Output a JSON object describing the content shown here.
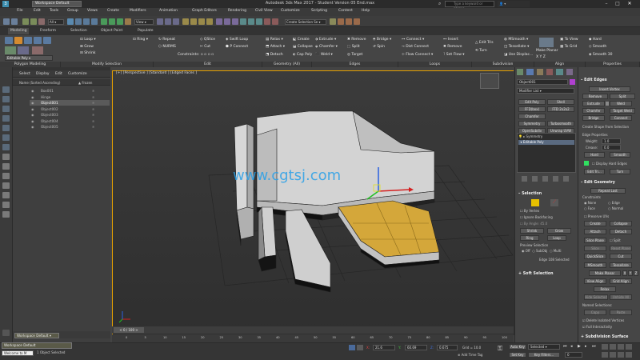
{
  "window": {
    "title": "Autodesk 3ds Max 2017 - Student Version   05 End.max",
    "workspace_label": "Workspace Default",
    "search_placeholder": "Type a keyword or phrase"
  },
  "menu": [
    "File",
    "Edit",
    "Tools",
    "Group",
    "Views",
    "Create",
    "Modifiers",
    "Animation",
    "Graph Editors",
    "Rendering",
    "Civil View",
    "Customize",
    "Scripting",
    "Content",
    "Help"
  ],
  "toolbar": {
    "view_dropdown": "View",
    "selection_set": "Create Selection Se"
  },
  "ribbon": {
    "tabs": [
      "Modeling",
      "Freeform",
      "Selection",
      "Object Paint",
      "Populate"
    ],
    "active_tab": "Modeling",
    "object_type": "Editable Poly",
    "row1": [
      "Loop",
      "Ring",
      "Repeat",
      "QSlice",
      "Swift Loop",
      "Relax",
      "Create",
      "Extrude",
      "Remove",
      "Bridge",
      "Connect",
      "Insert",
      "Edit Tris",
      "MSmooth",
      "To View",
      "Hard"
    ],
    "row2": [
      "Grow",
      "Shrink",
      "NURMS",
      "Cut",
      "P Connect",
      "Attach",
      "Collapse",
      "Chamfer",
      "Split",
      "Spin",
      "Dist Connect",
      "Remove",
      "Turn",
      "Tessellate",
      "To Grid",
      "Smooth"
    ],
    "row3": [
      "Constraints:",
      "Detach",
      "Cap Poly",
      "Weld",
      "Target",
      "Flow Connect",
      "Set Flow",
      "Use Displac...",
      "Make Planar",
      "X",
      "Y",
      "Z",
      "Smooth 30"
    ],
    "groups": [
      "Polygon Modeling",
      "Modify Selection",
      "Edit",
      "Geometry (All)",
      "Edges",
      "Loops",
      "Subdivision",
      "Align",
      "Properties"
    ]
  },
  "scene_explorer": {
    "tabs": [
      "Select",
      "Display",
      "Edit",
      "Customize"
    ],
    "column_name": "Name (Sorted Ascending)",
    "column_frozen": "Frozen",
    "items": [
      {
        "name": "Box001",
        "selected": false
      },
      {
        "name": "Hinge",
        "selected": false
      },
      {
        "name": "Object001",
        "selected": true
      },
      {
        "name": "Object002",
        "selected": false
      },
      {
        "name": "Object003",
        "selected": false
      },
      {
        "name": "Object004",
        "selected": false
      },
      {
        "name": "Object005",
        "selected": false
      }
    ],
    "workspace": "Workspace Default"
  },
  "viewport": {
    "label": "[+] [Perspective ] [Standard ] [Edged Faces ]",
    "watermark": "www.cgtsj.com",
    "colors": {
      "selected_faces": "#d4a73a",
      "frame": "#e5a000"
    }
  },
  "command_panel": {
    "object_name": "Object001",
    "modifier_list": "Modifier List",
    "buttons": [
      "Edit Poly",
      "Shell",
      "FFD(box)",
      "FFD 2x2x2",
      "Chamfer",
      "Symmetry",
      "Turbosmooth",
      "OpenSubdiv",
      "Unwrap UVW"
    ],
    "stack": [
      "Symmetry",
      "Editable Poly"
    ],
    "selection_header": "Selection",
    "by_vertex": "By Vertex",
    "ignore_backfacing": "Ignore Backfacing",
    "by_angle": "By Angle:",
    "by_angle_value": "45.0",
    "shrink": "Shrink",
    "grow": "Grow",
    "ring": "Ring",
    "loop": "Loop",
    "preview_selection": "Preview Selection",
    "preview_options": [
      "Off",
      "SubObj",
      "Multi"
    ],
    "status": "Edge 108 Selected",
    "soft_selection": "Soft Selection"
  },
  "edit_edges": {
    "header": "Edit Edges",
    "insert_vertex": "Insert Vertex",
    "remove": "Remove",
    "split": "Split",
    "extrude": "Extrude",
    "weld": "Weld",
    "chamfer": "Chamfer",
    "target_weld": "Target Weld",
    "bridge": "Bridge",
    "connect": "Connect",
    "create_shape": "Create Shape From Selection",
    "edge_properties": "Edge Properties",
    "weight_label": "Weight:",
    "weight": "1.0",
    "crease_label": "Crease:",
    "crease": "0.0",
    "hard": "Hard",
    "smooth": "Smooth",
    "display_hard": "Display Hard Edges",
    "edit_tri": "Edit Tri...",
    "turn": "Turn"
  },
  "edit_geometry": {
    "header": "Edit Geometry",
    "repeat_last": "Repeat Last",
    "constraints": "Constraints",
    "constraint_options": [
      "None",
      "Edge",
      "Face",
      "Normal"
    ],
    "preserve_uvs": "Preserve UVs",
    "create": "Create",
    "collapse": "Collapse",
    "attach": "Attach",
    "detach": "Detach",
    "slice_plane": "Slice Plane",
    "split": "Split",
    "slice": "Slice",
    "reset_plane": "Reset Plane",
    "quickslice": "QuickSlice",
    "cut": "Cut",
    "msmooth": "MSmooth",
    "tessellate": "Tessellate",
    "make_planar": "Make Planar",
    "x": "X",
    "y": "Y",
    "z": "Z",
    "view_align": "View Align",
    "grid_align": "Grid Align",
    "relax": "Relax",
    "hide_selected": "Hide Selected",
    "unhide_all": "Unhide All",
    "named_selections": "Named Selections:",
    "copy": "Copy",
    "paste": "Paste",
    "delete_isolated": "Delete Isolated Vertices",
    "full_interactivity": "Full Interactivity",
    "subdivision_surface": "Subdivision Surface"
  },
  "timeline": {
    "frame": "0 / 100",
    "ticks": [
      "0",
      "5",
      "10",
      "15",
      "20",
      "25",
      "30",
      "35",
      "40",
      "45",
      "50",
      "55",
      "60",
      "65",
      "70",
      "75",
      "80",
      "85",
      "90",
      "95",
      "100"
    ]
  },
  "statusbar": {
    "maxscript": "Welcome to M",
    "objects_selected": "1 Object Selected",
    "x_value": "21.6",
    "y_value": "60.69",
    "z_value": "0.675",
    "grid": "Grid = 10.0",
    "add_time_tag": "Add Time Tag",
    "auto_key": "Auto Key",
    "selected": "Selected",
    "set_key": "Set Key",
    "key_filters": "Key Filters...",
    "frame_field": "0"
  }
}
